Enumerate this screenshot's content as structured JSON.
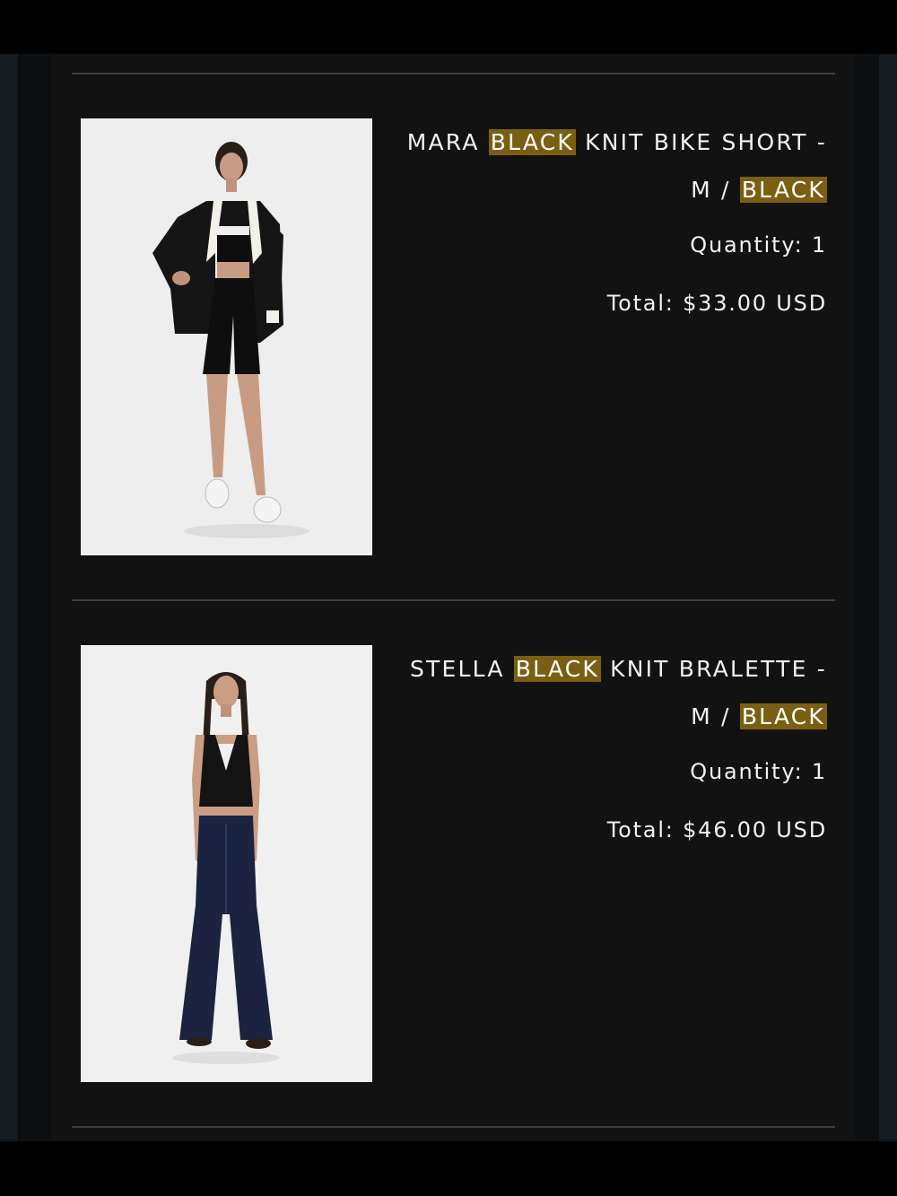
{
  "order_items": [
    {
      "title_prefix": "MARA ",
      "title_highlight": "BLACK",
      "title_suffix": " KNIT BIKE SHORT -",
      "variant_prefix": "M / ",
      "variant_highlight": "BLACK",
      "quantity": "Quantity: 1",
      "total": "Total: $33.00 USD",
      "image_icon": "product-photo-bike-short"
    },
    {
      "title_prefix": "STELLA ",
      "title_highlight": "BLACK",
      "title_suffix": " KNIT BRALETTE -",
      "variant_prefix": "M / ",
      "variant_highlight": "BLACK",
      "quantity": "Quantity: 1",
      "total": "Total: $46.00 USD",
      "image_icon": "product-photo-bralette"
    }
  ],
  "colors": {
    "page_background": "#121212",
    "highlight": "#7a5f12",
    "text": "#f2f2f2",
    "divider": "#3d3d3d"
  }
}
